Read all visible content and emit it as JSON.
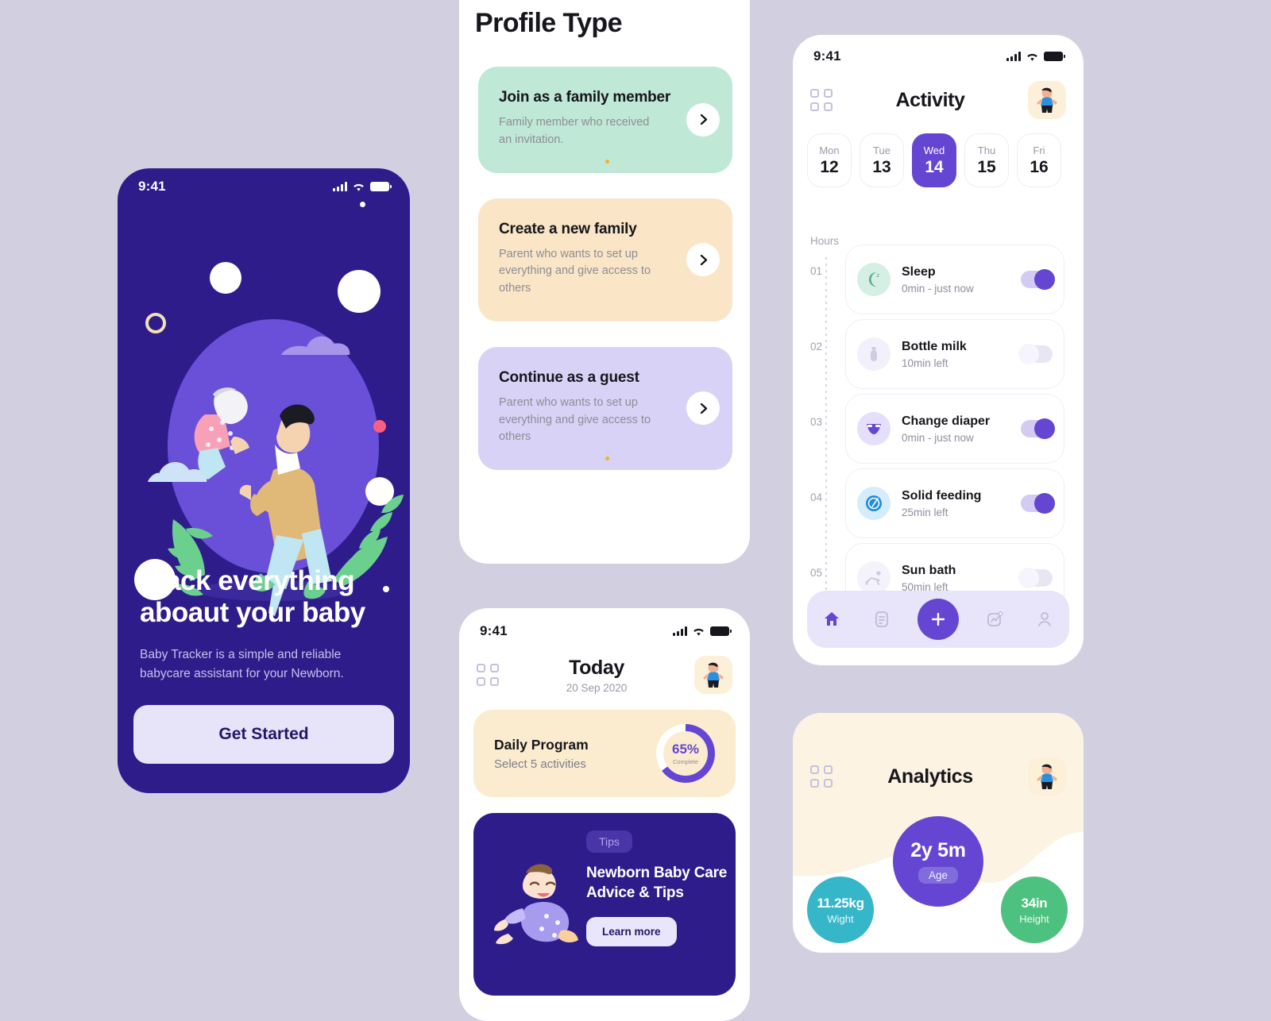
{
  "theme": {
    "page_background": "#d2cfe0",
    "primary_purple": "#6546d2",
    "deep_indigo": "#2e1c8b",
    "accent_yellow": "#f0b429"
  },
  "onboarding": {
    "status": {
      "time": "9:41",
      "signal_icon": "signal-bars-icon",
      "wifi_icon": "wifi-icon",
      "battery_icon": "battery-icon"
    },
    "illustration_name": "father-holding-baby-illustration",
    "title": "Track everything aboaut your baby",
    "subtitle": "Baby Tracker is a simple and reliable babycare assistant for your Newborn.",
    "cta_label": "Get Started"
  },
  "profile_type": {
    "title": "Profile Type",
    "options": [
      {
        "title": "Join as a family member",
        "description": "Family member who received an invitation.",
        "color": "#bfe8d6",
        "arrow_icon": "chevron-right-icon",
        "has_dot": true
      },
      {
        "title": "Create a new family",
        "description": "Parent who wants to set up everything and give access to others",
        "color": "#fae5c6",
        "arrow_icon": "chevron-right-icon",
        "has_dot": false
      },
      {
        "title": "Continue as a guest",
        "description": "Parent who wants to set up everything and give access to others",
        "color": "#d8d2f6",
        "arrow_icon": "chevron-right-icon",
        "has_dot": true
      }
    ]
  },
  "activity": {
    "status": {
      "time": "9:41"
    },
    "menu_icon": "grid-menu-icon",
    "title": "Activity",
    "avatar_icon": "baby-avatar-icon",
    "days": [
      {
        "name": "Mon",
        "date": "12",
        "active": false
      },
      {
        "name": "Tue",
        "date": "13",
        "active": false
      },
      {
        "name": "Wed",
        "date": "14",
        "active": true
      },
      {
        "name": "Thu",
        "date": "15",
        "active": false
      },
      {
        "name": "Fri",
        "date": "16",
        "active": false
      }
    ],
    "hours_label": "Hours",
    "hour_ticks": [
      "01",
      "02",
      "03",
      "04",
      "05"
    ],
    "items": [
      {
        "title": "Sleep",
        "subtitle": "0min - just now",
        "icon": "moon-sleep-icon",
        "icon_bg": "#d5efe4",
        "icon_color": "#4aab8b",
        "toggle": "on"
      },
      {
        "title": "Bottle milk",
        "subtitle": "10min left",
        "icon": "baby-bottle-icon",
        "icon_bg": "#f2f0fa",
        "icon_color": "#cfcbe2",
        "toggle": "off"
      },
      {
        "title": "Change diaper",
        "subtitle": "0min - just now",
        "icon": "diaper-icon",
        "icon_bg": "#e5dffb",
        "icon_color": "#6546d2",
        "toggle": "on"
      },
      {
        "title": "Solid feeding",
        "subtitle": "25min left",
        "icon": "plate-spoon-icon",
        "icon_bg": "#d7ecfb",
        "icon_color": "#1d8fe0",
        "toggle": "on"
      },
      {
        "title": "Sun bath",
        "subtitle": "50min left",
        "icon": "sun-lounger-icon",
        "icon_bg": "#f4f2fa",
        "icon_color": "#cfcbe2",
        "toggle": "off"
      }
    ],
    "tabs": [
      {
        "name": "home-tab",
        "icon": "home-icon",
        "active": true
      },
      {
        "name": "journal-tab",
        "icon": "document-icon",
        "active": false
      },
      {
        "name": "add-tab",
        "icon": "plus-icon",
        "active": false
      },
      {
        "name": "stats-tab",
        "icon": "chart-icon",
        "active": false
      },
      {
        "name": "profile-tab",
        "icon": "person-icon",
        "active": false
      }
    ]
  },
  "today": {
    "status": {
      "time": "9:41"
    },
    "menu_icon": "grid-menu-icon",
    "title": "Today",
    "date": "20 Sep 2020",
    "avatar_icon": "baby-avatar-icon",
    "daily_program": {
      "title": "Daily Program",
      "subtitle": "Select 5 activities",
      "percent": "65%",
      "percent_value": 65,
      "percent_caption": "Complete"
    },
    "tips": {
      "badge": "Tips",
      "heading": "Newborn Baby Care Advice & Tips",
      "button_label": "Learn more",
      "illustration_name": "crawling-baby-illustration"
    }
  },
  "analytics": {
    "menu_icon": "grid-menu-icon",
    "title": "Analytics",
    "avatar_icon": "baby-avatar-icon",
    "metrics": [
      {
        "value": "2y 5m",
        "label": "Age",
        "color": "#6546d2"
      },
      {
        "value": "11.25kg",
        "label": "Wight",
        "color": "#35b7c9"
      },
      {
        "value": "34in",
        "label": "Height",
        "color": "#4dc17f"
      }
    ]
  }
}
